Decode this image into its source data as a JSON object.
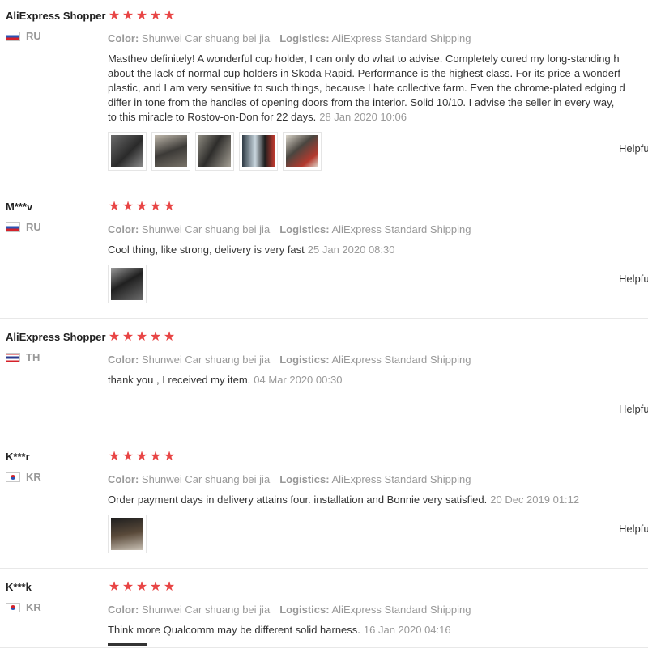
{
  "labels": {
    "color": "Color:",
    "logistics": "Logistics:",
    "helpful": "Helpful"
  },
  "accent_star_color": "#e84545",
  "reviews": [
    {
      "user": "AliExpress Shopper",
      "country": "RU",
      "flag": "russia-flag",
      "stars": 5,
      "color": "Shunwei Car shuang bei jia",
      "logistics": "AliExpress Standard Shipping",
      "lines": [
        "Masthev definitely! A wonderful cup holder, I can only do what to advise. Completely cured my long-standing h",
        "about the lack of normal cup holders in Skoda Rapid. Performance is the highest class. For its price-a wonderf",
        "plastic, and I am very sensitive to such things, because I hate collective farm. Even the chrome-plated edging d",
        "differ in tone from the handles of opening doors from the interior. Solid 10/10. I advise the seller in every way,",
        "to this miracle to Rostov-on-Don for 22 days."
      ],
      "date": "28 Jan 2020 10:06",
      "photos": [
        "photo-1",
        "photo-2",
        "photo-3",
        "photo-4",
        "photo-5"
      ]
    },
    {
      "user": "M***v",
      "country": "RU",
      "flag": "russia-flag",
      "stars": 5,
      "color": "Shunwei Car shuang bei jia",
      "logistics": "AliExpress Standard Shipping",
      "lines": [
        "Cool thing, like strong, delivery is very fast"
      ],
      "date": "25 Jan 2020 08:30",
      "photos": [
        "photo-1"
      ]
    },
    {
      "user": "AliExpress Shopper",
      "country": "TH",
      "flag": "thailand-flag",
      "stars": 5,
      "color": "Shunwei Car shuang bei jia",
      "logistics": "AliExpress Standard Shipping",
      "lines": [
        "thank you , I received my item."
      ],
      "date": "04 Mar 2020 00:30",
      "photos": []
    },
    {
      "user": "K***r",
      "country": "KR",
      "flag": "south-korea-flag",
      "stars": 5,
      "color": "Shunwei Car shuang bei jia",
      "logistics": "AliExpress Standard Shipping",
      "lines": [
        "Order payment days in delivery attains four. installation and Bonnie very satisfied."
      ],
      "date": "20 Dec 2019 01:12",
      "photos": [
        "photo-1"
      ]
    },
    {
      "user": "K***k",
      "country": "KR",
      "flag": "south-korea-flag",
      "stars": 5,
      "color": "Shunwei Car shuang bei jia",
      "logistics": "AliExpress Standard Shipping",
      "lines": [
        "Think more Qualcomm may be different solid harness."
      ],
      "date": "16 Jan 2020 04:16",
      "photos": []
    }
  ]
}
